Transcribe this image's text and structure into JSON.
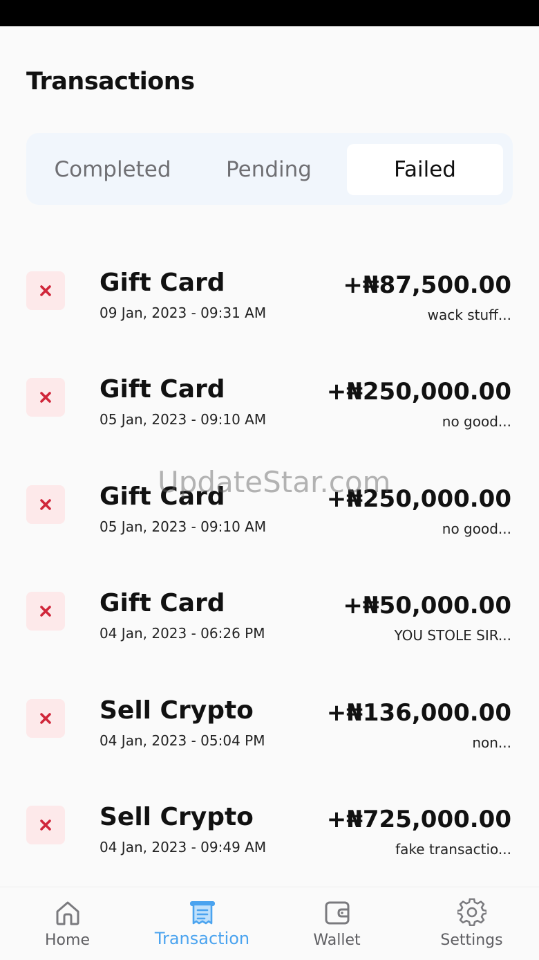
{
  "header": {
    "title": "Transactions"
  },
  "tabs": [
    {
      "label": "Completed",
      "active": false
    },
    {
      "label": "Pending",
      "active": false
    },
    {
      "label": "Failed",
      "active": true
    }
  ],
  "transactions": [
    {
      "name": "Gift Card",
      "date": "09 Jan, 2023 - 09:31 AM",
      "amount": "+₦87,500.00",
      "note": "wack stuff...",
      "status_icon": "failed-x-icon"
    },
    {
      "name": "Gift Card",
      "date": "05 Jan, 2023 - 09:10 AM",
      "amount": "+₦250,000.00",
      "note": "no good...",
      "status_icon": "failed-x-icon"
    },
    {
      "name": "Gift Card",
      "date": "05 Jan, 2023 - 09:10 AM",
      "amount": "+₦250,000.00",
      "note": "no good...",
      "status_icon": "failed-x-icon"
    },
    {
      "name": "Gift Card",
      "date": "04 Jan, 2023 - 06:26 PM",
      "amount": "+₦50,000.00",
      "note": "YOU STOLE SIR...",
      "status_icon": "failed-x-icon"
    },
    {
      "name": "Sell Crypto",
      "date": "04 Jan, 2023 - 05:04 PM",
      "amount": "+₦136,000.00",
      "note": "non...",
      "status_icon": "failed-x-icon"
    },
    {
      "name": "Sell Crypto",
      "date": "04 Jan, 2023 - 09:49 AM",
      "amount": "+₦725,000.00",
      "note": "fake transactio...",
      "status_icon": "failed-x-icon"
    }
  ],
  "watermark": "UpdateStar.com",
  "bottom_nav": [
    {
      "label": "Home",
      "icon": "home-icon",
      "active": false
    },
    {
      "label": "Transaction",
      "icon": "receipt-icon",
      "active": true
    },
    {
      "label": "Wallet",
      "icon": "wallet-icon",
      "active": false
    },
    {
      "label": "Settings",
      "icon": "gear-icon",
      "active": false
    }
  ],
  "colors": {
    "accent": "#4aa3ef",
    "failed": "#d0263a",
    "failed_bg": "#fde9ea",
    "tab_bg": "#f1f6fc"
  }
}
